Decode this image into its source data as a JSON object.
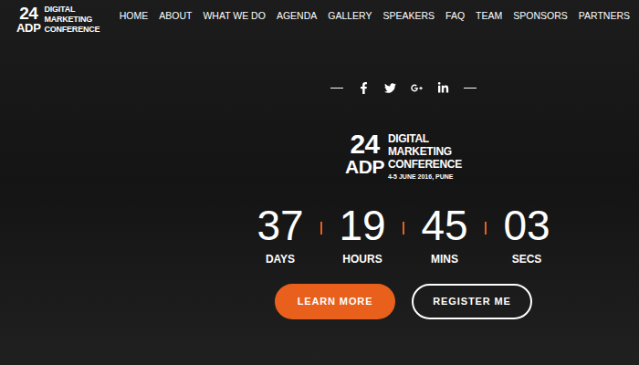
{
  "header": {
    "logo": {
      "number": "24",
      "acronym": "ADP",
      "lines": [
        "DIGITAL",
        "MARKETING",
        "CONFERENCE"
      ]
    },
    "nav": [
      {
        "label": "HOME",
        "selected": false
      },
      {
        "label": "ABOUT",
        "selected": false
      },
      {
        "label": "WHAT WE DO",
        "selected": false
      },
      {
        "label": "AGENDA",
        "selected": false
      },
      {
        "label": "GALLERY",
        "selected": false
      },
      {
        "label": "SPEAKERS",
        "selected": false
      },
      {
        "label": "FAQ",
        "selected": false
      },
      {
        "label": "TEAM",
        "selected": false
      },
      {
        "label": "SPONSORS",
        "selected": false
      },
      {
        "label": "PARTNERS",
        "selected": false
      }
    ]
  },
  "hero_logo": {
    "number": "24",
    "acronym": "ADP",
    "lines": [
      "DIGITAL",
      "MARKETING",
      "CONFERENCE"
    ],
    "date": "4-5 JUNE 2016, PUNE"
  },
  "countdown": [
    {
      "value": "37",
      "unit": "DAYS"
    },
    {
      "value": "19",
      "unit": "HOURS"
    },
    {
      "value": "45",
      "unit": "MINS"
    },
    {
      "value": "03",
      "unit": "SECS"
    }
  ],
  "buttons": [
    {
      "label": "LEARN MORE",
      "kind": "primary"
    },
    {
      "label": "REGISTER ME",
      "kind": "outline"
    }
  ]
}
